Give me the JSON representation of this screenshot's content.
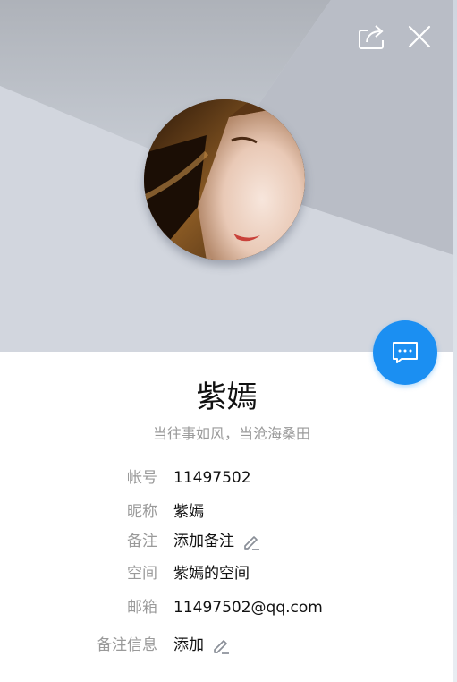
{
  "profile": {
    "name": "紫嫣",
    "signature": "当往事如风，当沧海桑田"
  },
  "header": {
    "share_icon": "share-icon",
    "close_icon": "close-icon"
  },
  "chat_button": {
    "icon": "chat-bubble-icon",
    "color": "#1b8ff2"
  },
  "info": {
    "account": {
      "label": "帐号",
      "value": "11497502"
    },
    "nickname": {
      "label": "昵称",
      "value": "紫嫣"
    },
    "remark": {
      "label": "备注",
      "value": "添加备注"
    },
    "space": {
      "label": "空间",
      "value": "紫嫣的空间"
    },
    "email": {
      "label": "邮箱",
      "value": "11497502@qq.com"
    },
    "remark_info": {
      "label": "备注信息",
      "value": "添加"
    }
  },
  "colors": {
    "header_bg": "#cdd2da",
    "label": "#9a9a9a",
    "text": "#111111",
    "accent": "#1b8ff2"
  }
}
